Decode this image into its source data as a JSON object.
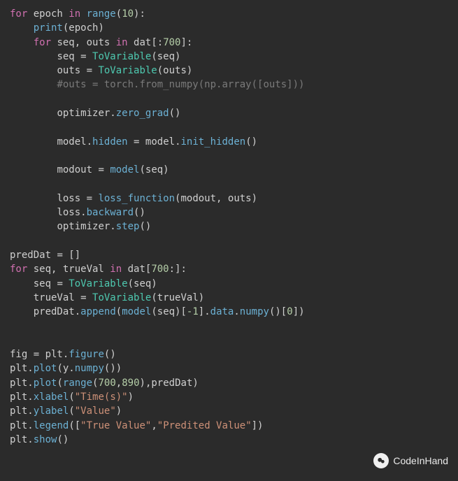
{
  "code": {
    "lines": [
      {
        "indent": 0,
        "tokens": [
          {
            "t": "for ",
            "c": "kw"
          },
          {
            "t": "epoch ",
            "c": "var"
          },
          {
            "t": "in ",
            "c": "kw"
          },
          {
            "t": "range",
            "c": "builtin"
          },
          {
            "t": "(",
            "c": "pun"
          },
          {
            "t": "10",
            "c": "num"
          },
          {
            "t": "):",
            "c": "pun"
          }
        ]
      },
      {
        "indent": 1,
        "tokens": [
          {
            "t": "print",
            "c": "builtin"
          },
          {
            "t": "(epoch)",
            "c": "pun"
          }
        ]
      },
      {
        "indent": 1,
        "tokens": [
          {
            "t": "for ",
            "c": "kw"
          },
          {
            "t": "seq, outs ",
            "c": "var"
          },
          {
            "t": "in ",
            "c": "kw"
          },
          {
            "t": "dat",
            "c": "var"
          },
          {
            "t": "[:",
            "c": "pun"
          },
          {
            "t": "700",
            "c": "num"
          },
          {
            "t": "]:",
            "c": "pun"
          }
        ]
      },
      {
        "indent": 2,
        "tokens": [
          {
            "t": "seq ",
            "c": "var"
          },
          {
            "t": "= ",
            "c": "op"
          },
          {
            "t": "ToVariable",
            "c": "def"
          },
          {
            "t": "(seq)",
            "c": "pun"
          }
        ]
      },
      {
        "indent": 2,
        "tokens": [
          {
            "t": "outs ",
            "c": "var"
          },
          {
            "t": "= ",
            "c": "op"
          },
          {
            "t": "ToVariable",
            "c": "def"
          },
          {
            "t": "(outs)",
            "c": "pun"
          }
        ]
      },
      {
        "indent": 2,
        "tokens": [
          {
            "t": "#outs = torch.from_numpy(np.array([outs]))",
            "c": "cmt"
          }
        ]
      },
      {
        "indent": 0,
        "tokens": [
          {
            "t": "",
            "c": "pun"
          }
        ]
      },
      {
        "indent": 2,
        "tokens": [
          {
            "t": "optimizer",
            "c": "var"
          },
          {
            "t": ".",
            "c": "pun"
          },
          {
            "t": "zero_grad",
            "c": "func"
          },
          {
            "t": "()",
            "c": "pun"
          }
        ]
      },
      {
        "indent": 0,
        "tokens": [
          {
            "t": "",
            "c": "pun"
          }
        ]
      },
      {
        "indent": 2,
        "tokens": [
          {
            "t": "model",
            "c": "var"
          },
          {
            "t": ".",
            "c": "pun"
          },
          {
            "t": "hidden",
            "c": "func"
          },
          {
            "t": " = ",
            "c": "op"
          },
          {
            "t": "model",
            "c": "var"
          },
          {
            "t": ".",
            "c": "pun"
          },
          {
            "t": "init_hidden",
            "c": "func"
          },
          {
            "t": "()",
            "c": "pun"
          }
        ]
      },
      {
        "indent": 0,
        "tokens": [
          {
            "t": "",
            "c": "pun"
          }
        ]
      },
      {
        "indent": 2,
        "tokens": [
          {
            "t": "modout ",
            "c": "var"
          },
          {
            "t": "= ",
            "c": "op"
          },
          {
            "t": "model",
            "c": "func"
          },
          {
            "t": "(seq)",
            "c": "pun"
          }
        ]
      },
      {
        "indent": 0,
        "tokens": [
          {
            "t": "",
            "c": "pun"
          }
        ]
      },
      {
        "indent": 2,
        "tokens": [
          {
            "t": "loss ",
            "c": "var"
          },
          {
            "t": "= ",
            "c": "op"
          },
          {
            "t": "loss_function",
            "c": "func"
          },
          {
            "t": "(modout, outs)",
            "c": "pun"
          }
        ]
      },
      {
        "indent": 2,
        "tokens": [
          {
            "t": "loss",
            "c": "var"
          },
          {
            "t": ".",
            "c": "pun"
          },
          {
            "t": "backward",
            "c": "func"
          },
          {
            "t": "()",
            "c": "pun"
          }
        ]
      },
      {
        "indent": 2,
        "tokens": [
          {
            "t": "optimizer",
            "c": "var"
          },
          {
            "t": ".",
            "c": "pun"
          },
          {
            "t": "step",
            "c": "func"
          },
          {
            "t": "()",
            "c": "pun"
          }
        ]
      },
      {
        "indent": 0,
        "tokens": [
          {
            "t": "",
            "c": "pun"
          }
        ]
      },
      {
        "indent": 0,
        "tokens": [
          {
            "t": "predDat ",
            "c": "var"
          },
          {
            "t": "= ",
            "c": "op"
          },
          {
            "t": "[]",
            "c": "pun"
          }
        ]
      },
      {
        "indent": 0,
        "tokens": [
          {
            "t": "for ",
            "c": "kw"
          },
          {
            "t": "seq, trueVal ",
            "c": "var"
          },
          {
            "t": "in ",
            "c": "kw"
          },
          {
            "t": "dat",
            "c": "var"
          },
          {
            "t": "[",
            "c": "pun"
          },
          {
            "t": "700",
            "c": "num"
          },
          {
            "t": ":]:",
            "c": "pun"
          }
        ]
      },
      {
        "indent": 1,
        "tokens": [
          {
            "t": "seq ",
            "c": "var"
          },
          {
            "t": "= ",
            "c": "op"
          },
          {
            "t": "ToVariable",
            "c": "def"
          },
          {
            "t": "(seq)",
            "c": "pun"
          }
        ]
      },
      {
        "indent": 1,
        "tokens": [
          {
            "t": "trueVal ",
            "c": "var"
          },
          {
            "t": "= ",
            "c": "op"
          },
          {
            "t": "ToVariable",
            "c": "def"
          },
          {
            "t": "(trueVal)",
            "c": "pun"
          }
        ]
      },
      {
        "indent": 1,
        "tokens": [
          {
            "t": "predDat",
            "c": "var"
          },
          {
            "t": ".",
            "c": "pun"
          },
          {
            "t": "append",
            "c": "func"
          },
          {
            "t": "(",
            "c": "pun"
          },
          {
            "t": "model",
            "c": "func"
          },
          {
            "t": "(seq)[",
            "c": "pun"
          },
          {
            "t": "-1",
            "c": "num"
          },
          {
            "t": "].",
            "c": "pun"
          },
          {
            "t": "data",
            "c": "func"
          },
          {
            "t": ".",
            "c": "pun"
          },
          {
            "t": "numpy",
            "c": "func"
          },
          {
            "t": "()[",
            "c": "pun"
          },
          {
            "t": "0",
            "c": "num"
          },
          {
            "t": "])",
            "c": "pun"
          }
        ]
      },
      {
        "indent": 0,
        "tokens": [
          {
            "t": "",
            "c": "pun"
          }
        ]
      },
      {
        "indent": 0,
        "tokens": [
          {
            "t": "",
            "c": "pun"
          }
        ]
      },
      {
        "indent": 0,
        "tokens": [
          {
            "t": "fig ",
            "c": "var"
          },
          {
            "t": "= ",
            "c": "op"
          },
          {
            "t": "plt",
            "c": "var"
          },
          {
            "t": ".",
            "c": "pun"
          },
          {
            "t": "figure",
            "c": "func"
          },
          {
            "t": "()",
            "c": "pun"
          }
        ]
      },
      {
        "indent": 0,
        "tokens": [
          {
            "t": "plt",
            "c": "var"
          },
          {
            "t": ".",
            "c": "pun"
          },
          {
            "t": "plot",
            "c": "func"
          },
          {
            "t": "(y.",
            "c": "pun"
          },
          {
            "t": "numpy",
            "c": "func"
          },
          {
            "t": "())",
            "c": "pun"
          }
        ]
      },
      {
        "indent": 0,
        "tokens": [
          {
            "t": "plt",
            "c": "var"
          },
          {
            "t": ".",
            "c": "pun"
          },
          {
            "t": "plot",
            "c": "func"
          },
          {
            "t": "(",
            "c": "pun"
          },
          {
            "t": "range",
            "c": "builtin"
          },
          {
            "t": "(",
            "c": "pun"
          },
          {
            "t": "700",
            "c": "num"
          },
          {
            "t": ",",
            "c": "pun"
          },
          {
            "t": "890",
            "c": "num"
          },
          {
            "t": "),predDat)",
            "c": "pun"
          }
        ]
      },
      {
        "indent": 0,
        "tokens": [
          {
            "t": "plt",
            "c": "var"
          },
          {
            "t": ".",
            "c": "pun"
          },
          {
            "t": "xlabel",
            "c": "func"
          },
          {
            "t": "(",
            "c": "pun"
          },
          {
            "t": "\"Time(s)\"",
            "c": "str"
          },
          {
            "t": ")",
            "c": "pun"
          }
        ]
      },
      {
        "indent": 0,
        "tokens": [
          {
            "t": "plt",
            "c": "var"
          },
          {
            "t": ".",
            "c": "pun"
          },
          {
            "t": "ylabel",
            "c": "func"
          },
          {
            "t": "(",
            "c": "pun"
          },
          {
            "t": "\"Value\"",
            "c": "str"
          },
          {
            "t": ")",
            "c": "pun"
          }
        ]
      },
      {
        "indent": 0,
        "tokens": [
          {
            "t": "plt",
            "c": "var"
          },
          {
            "t": ".",
            "c": "pun"
          },
          {
            "t": "legend",
            "c": "func"
          },
          {
            "t": "([",
            "c": "pun"
          },
          {
            "t": "\"True Value\"",
            "c": "str"
          },
          {
            "t": ",",
            "c": "pun"
          },
          {
            "t": "\"Predited Value\"",
            "c": "str"
          },
          {
            "t": "])",
            "c": "pun"
          }
        ]
      },
      {
        "indent": 0,
        "tokens": [
          {
            "t": "plt",
            "c": "var"
          },
          {
            "t": ".",
            "c": "pun"
          },
          {
            "t": "show",
            "c": "func"
          },
          {
            "t": "()",
            "c": "pun"
          }
        ]
      }
    ]
  },
  "watermark": {
    "text": "CodeInHand"
  },
  "colors": {
    "background": "#2b2b2b",
    "keyword": "#d070b0",
    "function": "#6cb1d4",
    "number": "#b5cea8",
    "string": "#ce9178",
    "comment": "#7a7a7a",
    "default": "#d0d0d0",
    "classdef": "#4ec9b0"
  }
}
